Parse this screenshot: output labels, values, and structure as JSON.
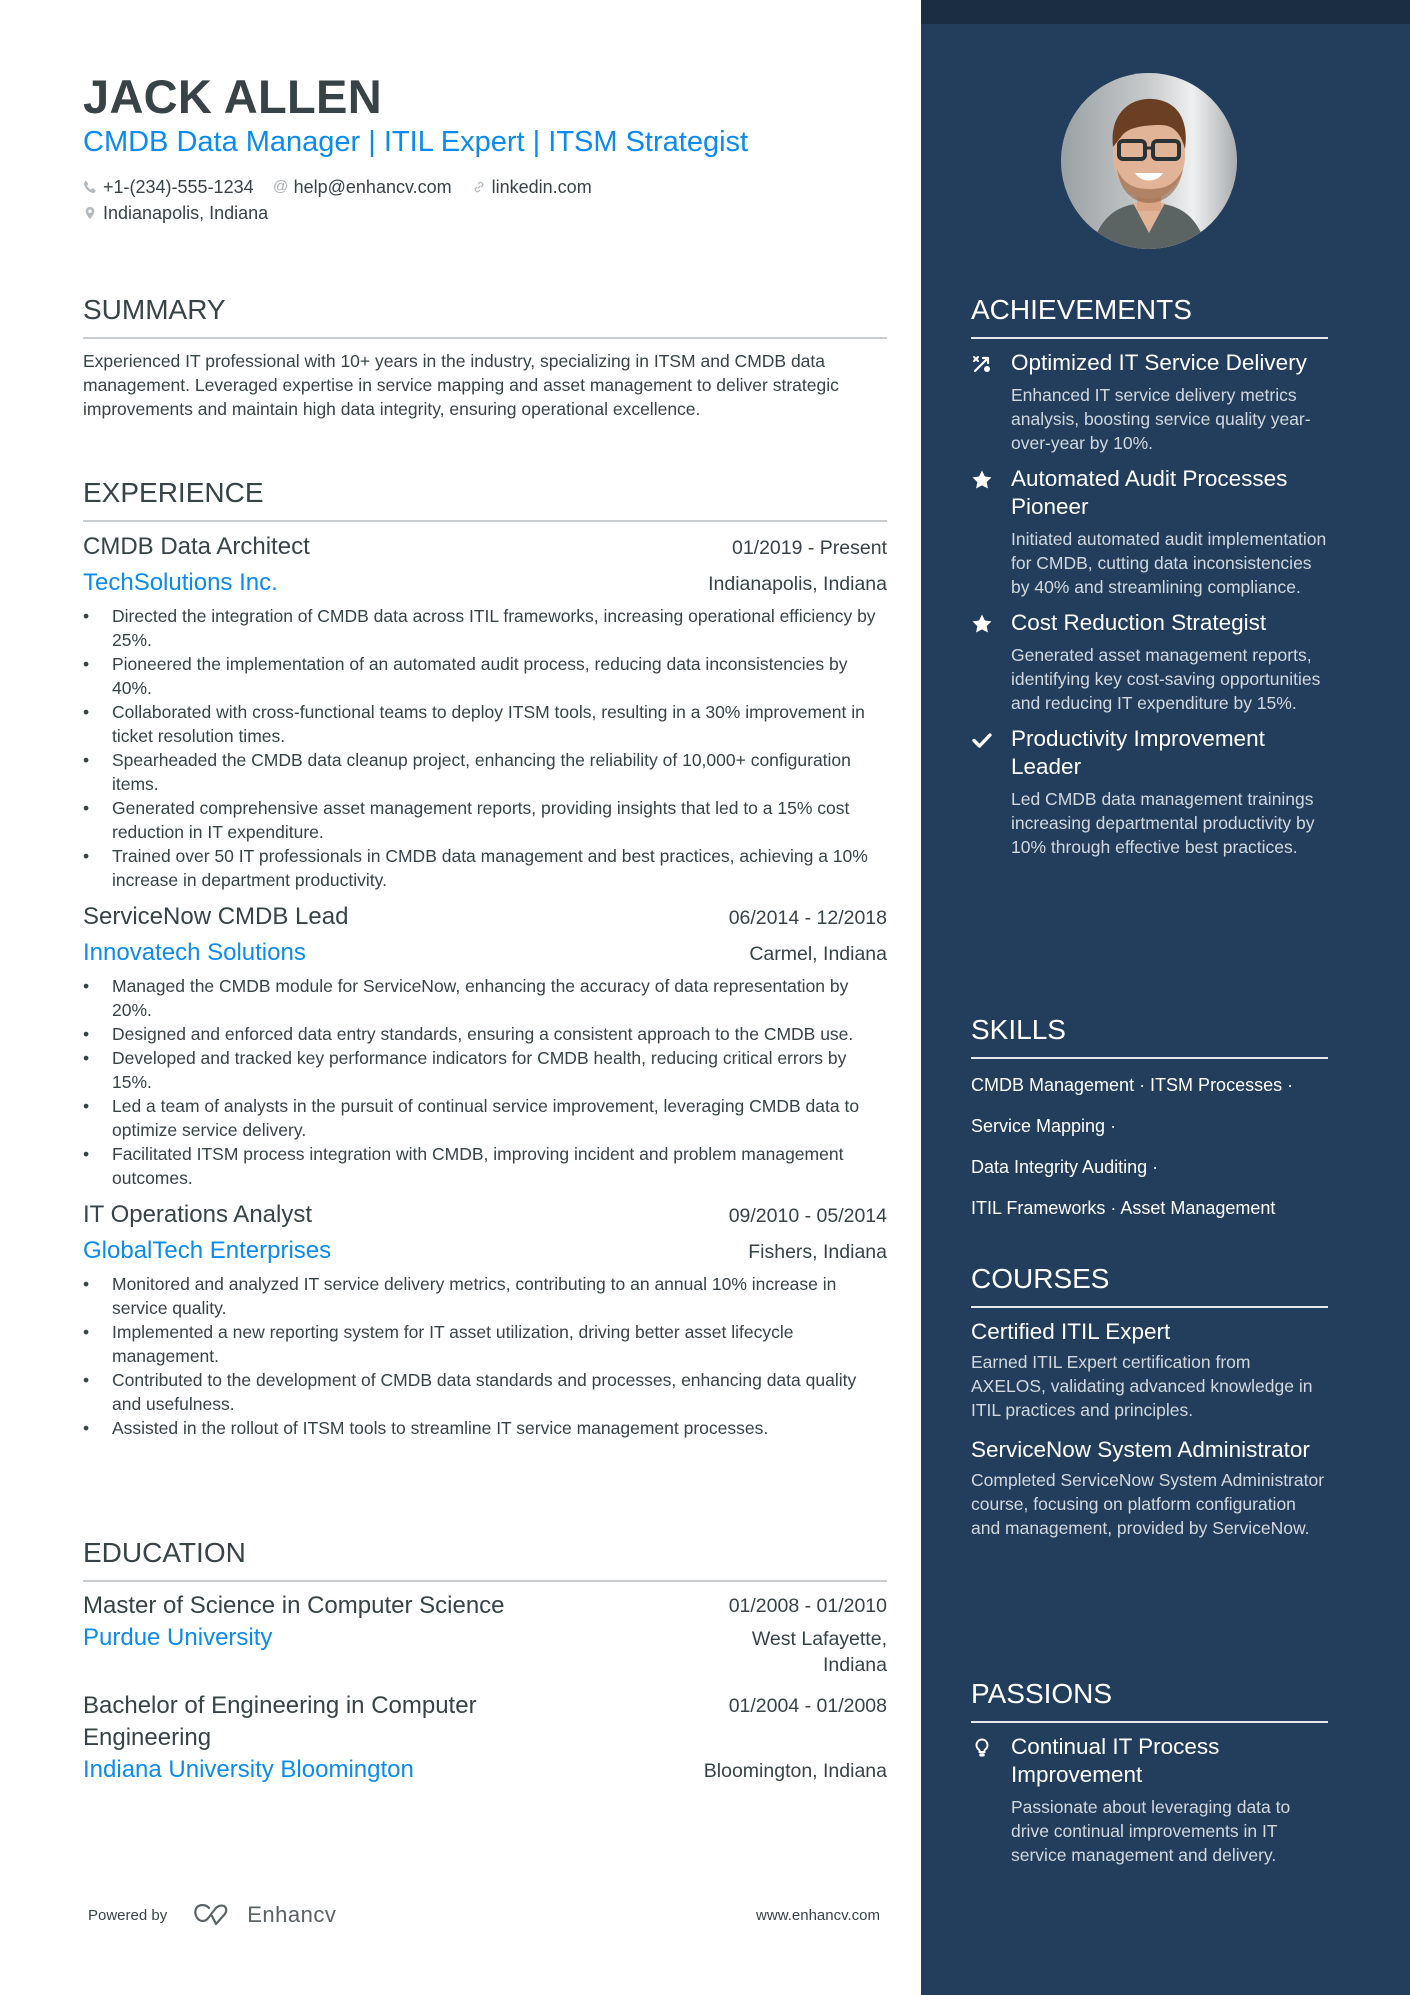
{
  "header": {
    "name": "JACK ALLEN",
    "title": "CMDB Data Manager | ITIL Expert | ITSM Strategist",
    "contacts": {
      "phone": {
        "icon": "phone-icon",
        "text": "+1-(234)-555-1234"
      },
      "email": {
        "icon": "at-icon",
        "text": "help@enhancv.com"
      },
      "linkedin": {
        "icon": "link-icon",
        "text": "linkedin.com"
      },
      "location": {
        "icon": "location-pin-icon",
        "text": "Indianapolis, Indiana"
      }
    }
  },
  "summary": {
    "title": "SUMMARY",
    "text": "Experienced IT professional with 10+ years in the industry, specializing in ITSM and CMDB data management. Leveraged expertise in service mapping and asset management to deliver strategic improvements and maintain high data integrity, ensuring operational excellence."
  },
  "experience": {
    "title": "EXPERIENCE",
    "jobs": [
      {
        "role": "CMDB Data Architect",
        "dates": "01/2019 - Present",
        "company": "TechSolutions Inc.",
        "location": "Indianapolis, Indiana",
        "bullets": [
          "Directed the integration of CMDB data across ITIL frameworks, increasing operational efficiency by 25%.",
          "Pioneered the implementation of an automated audit process, reducing data inconsistencies by 40%.",
          "Collaborated with cross-functional teams to deploy ITSM tools, resulting in a 30% improvement in ticket resolution times.",
          "Spearheaded the CMDB data cleanup project, enhancing the reliability of 10,000+ configuration items.",
          "Generated comprehensive asset management reports, providing insights that led to a 15% cost reduction in IT expenditure.",
          "Trained over 50 IT professionals in CMDB data management and best practices, achieving a 10% increase in department productivity."
        ]
      },
      {
        "role": "ServiceNow CMDB Lead",
        "dates": "06/2014 - 12/2018",
        "company": "Innovatech Solutions",
        "location": "Carmel, Indiana",
        "bullets": [
          "Managed the CMDB module for ServiceNow, enhancing the accuracy of data representation by 20%.",
          "Designed and enforced data entry standards, ensuring a consistent approach to the CMDB use.",
          "Developed and tracked key performance indicators for CMDB health, reducing critical errors by 15%.",
          "Led a team of analysts in the pursuit of continual service improvement, leveraging CMDB data to optimize service delivery.",
          "Facilitated ITSM process integration with CMDB, improving incident and problem management outcomes."
        ]
      },
      {
        "role": "IT Operations Analyst",
        "dates": "09/2010 - 05/2014",
        "company": "GlobalTech Enterprises",
        "location": "Fishers, Indiana",
        "bullets": [
          "Monitored and analyzed IT service delivery metrics, contributing to an annual 10% increase in service quality.",
          "Implemented a new reporting system for IT asset utilization, driving better asset lifecycle management.",
          "Contributed to the development of CMDB data standards and processes, enhancing data quality and usefulness.",
          "Assisted in the rollout of ITSM tools to streamline IT service management processes."
        ]
      }
    ]
  },
  "education": {
    "title": "EDUCATION",
    "items": [
      {
        "degree": "Master of Science in Computer Science",
        "dates": "01/2008 - 01/2010",
        "school": "Purdue University",
        "location": "West Lafayette, Indiana"
      },
      {
        "degree": "Bachelor of Engineering in Computer Engineering",
        "dates": "01/2004 - 01/2008",
        "school": "Indiana University Bloomington",
        "location": "Bloomington, Indiana"
      }
    ]
  },
  "footer": {
    "powered_by": "Powered by",
    "brand": "Enhancv",
    "website": "www.enhancv.com"
  },
  "sidebar": {
    "photo_alt": "Profile photo of Jack Allen",
    "achievements": {
      "title": "ACHIEVEMENTS",
      "items": [
        {
          "icon": "route-icon",
          "title": "Optimized IT Service Delivery",
          "desc": "Enhanced IT service delivery metrics analysis, boosting service quality year-over-year by 10%."
        },
        {
          "icon": "star-icon",
          "title": "Automated Audit Processes Pioneer",
          "desc": "Initiated automated audit implementation for CMDB, cutting data inconsistencies by 40% and streamlining compliance."
        },
        {
          "icon": "star-icon",
          "title": "Cost Reduction Strategist",
          "desc": "Generated asset management reports, identifying key cost-saving opportunities and reducing IT expenditure by 15%."
        },
        {
          "icon": "checkmark-icon",
          "title": "Productivity Improvement Leader",
          "desc": "Led CMDB data management trainings increasing departmental productivity by 10% through effective best practices."
        }
      ]
    },
    "skills": {
      "title": "SKILLS",
      "lines": [
        "CMDB Management · ITSM Processes ·",
        "Service Mapping ·",
        "Data Integrity Auditing ·",
        "ITIL Frameworks · Asset Management"
      ]
    },
    "courses": {
      "title": "COURSES",
      "items": [
        {
          "title": "Certified ITIL Expert",
          "desc": "Earned ITIL Expert certification from AXELOS, validating advanced knowledge in ITIL practices and principles."
        },
        {
          "title": "ServiceNow System Administrator",
          "desc": "Completed ServiceNow System Administrator course, focusing on platform configuration and management, provided by ServiceNow."
        }
      ]
    },
    "passions": {
      "title": "PASSIONS",
      "items": [
        {
          "icon": "lightbulb-icon",
          "title": "Continual IT Process Improvement",
          "desc": "Passionate about leveraging data to drive continual improvements in IT service management and delivery."
        }
      ]
    }
  },
  "colors": {
    "accent": "#0b8bf0",
    "text": "#384347",
    "sidebar_bg": "#223e5c",
    "sidebar_band": "#1b2d43"
  }
}
